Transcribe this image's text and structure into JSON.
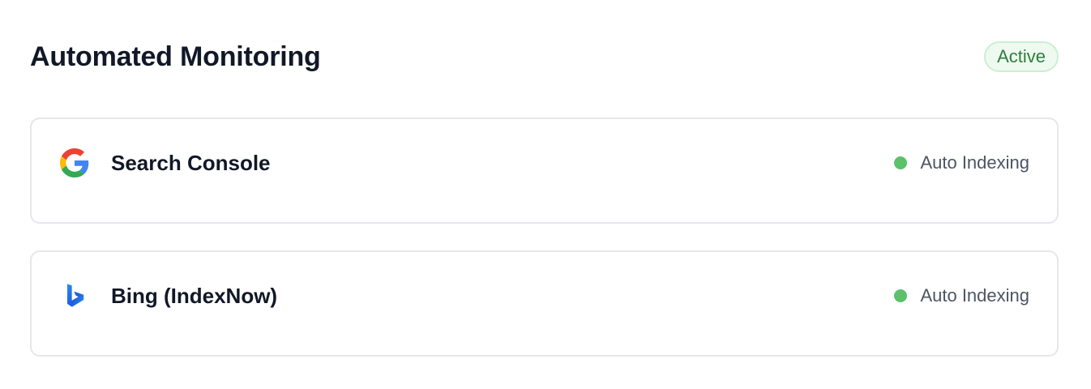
{
  "page": {
    "title": "Automated Monitoring",
    "status_badge": "Active"
  },
  "integrations": [
    {
      "name": "Search Console",
      "icon": "google-logo-icon",
      "status_label": "Auto Indexing",
      "status_color": "#5cc16a"
    },
    {
      "name": "Bing (IndexNow)",
      "icon": "bing-logo-icon",
      "status_label": "Auto Indexing",
      "status_color": "#5cc16a"
    }
  ],
  "colors": {
    "badge_text": "#2f7d3e",
    "badge_bg": "#eefaf0",
    "badge_border": "#cdeed3",
    "card_border": "#e5e7eb"
  }
}
